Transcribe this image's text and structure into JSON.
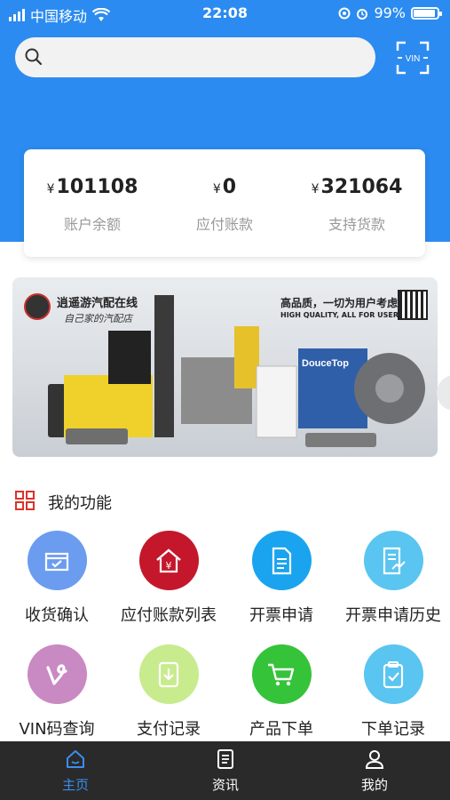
{
  "status_bar": {
    "carrier": "中国移动",
    "time": "22:08",
    "battery": "99%"
  },
  "search": {
    "placeholder": "",
    "vin_label": "VIN"
  },
  "account": [
    {
      "amount": "101108",
      "label": "账户余额",
      "currency": "¥"
    },
    {
      "amount": "0",
      "label": "应付账款",
      "currency": "¥"
    },
    {
      "amount": "321064",
      "label": "支持货款",
      "currency": "¥"
    }
  ],
  "banner": {
    "brand": "逍遥游汽配在线",
    "slogan": "自己家的汽配店",
    "headline": "高品质，一切为用户考虑",
    "subheadline": "HIGH QUALITY, ALL FOR USERS"
  },
  "functions": {
    "title": "我的功能",
    "items": [
      {
        "label": "收货确认",
        "color": "#6b9cf0",
        "icon": "inbox-check-icon"
      },
      {
        "label": "应付账款列表",
        "color": "#c4172c",
        "icon": "house-yen-icon"
      },
      {
        "label": "开票申请",
        "color": "#1aa4ef",
        "icon": "document-icon"
      },
      {
        "label": "开票申请历史",
        "color": "#59c5f0",
        "icon": "document-history-icon"
      },
      {
        "label": "VIN码查询",
        "color": "#c989c2",
        "icon": "vine-v-icon"
      },
      {
        "label": "支付记录",
        "color": "#c8eb8e",
        "icon": "download-card-icon"
      },
      {
        "label": "产品下单",
        "color": "#35c33a",
        "icon": "cart-icon"
      },
      {
        "label": "下单记录",
        "color": "#59c5f0",
        "icon": "clipboard-check-icon"
      }
    ]
  },
  "tabbar": {
    "items": [
      {
        "label": "主页",
        "icon": "home-icon",
        "active": true
      },
      {
        "label": "资讯",
        "icon": "news-icon",
        "active": false
      },
      {
        "label": "我的",
        "icon": "user-icon",
        "active": false
      }
    ]
  },
  "colors": {
    "header_blue": "#2b8bf0",
    "tab_active": "#3a8ef0",
    "tabbar_bg": "#2a2a2a"
  }
}
